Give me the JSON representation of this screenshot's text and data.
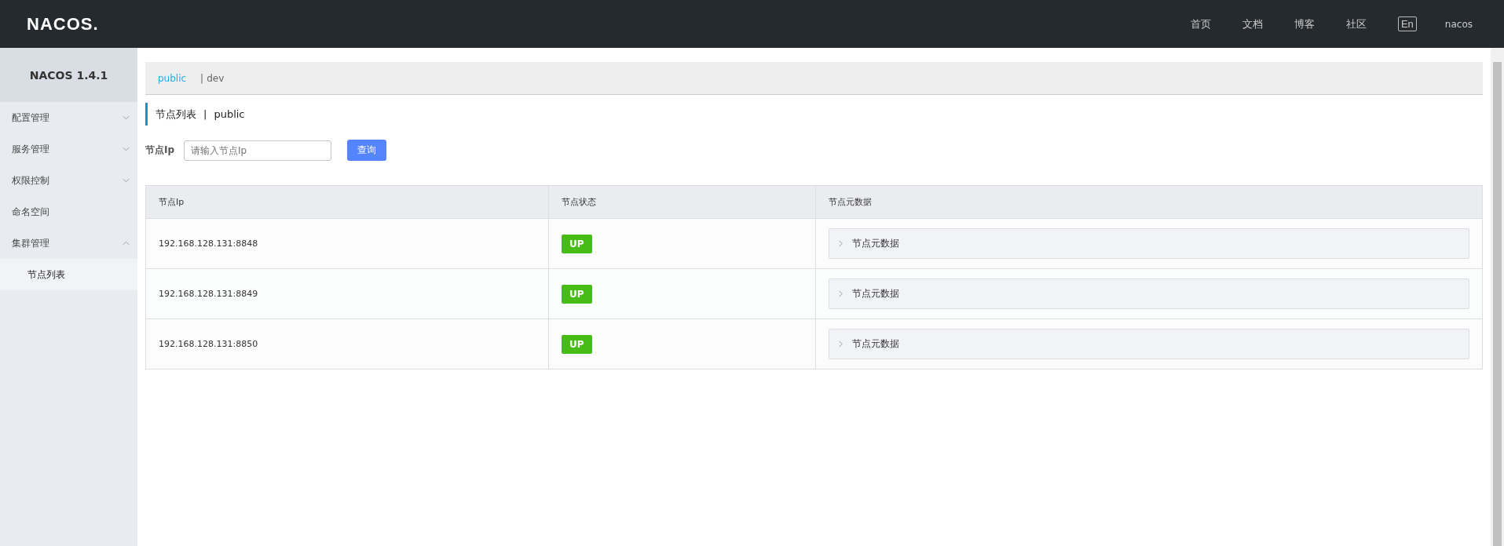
{
  "header": {
    "logo": "NACOS.",
    "nav": [
      "首页",
      "文档",
      "博客",
      "社区"
    ],
    "language": "En",
    "user": "nacos"
  },
  "sidebar": {
    "title": "NACOS 1.4.1",
    "items": [
      {
        "label": "配置管理",
        "expandable": true,
        "expanded": false
      },
      {
        "label": "服务管理",
        "expandable": true,
        "expanded": false
      },
      {
        "label": "权限控制",
        "expandable": true,
        "expanded": false
      },
      {
        "label": "命名空间",
        "expandable": false
      },
      {
        "label": "集群管理",
        "expandable": true,
        "expanded": true,
        "children": [
          {
            "label": "节点列表",
            "selected": true
          }
        ]
      }
    ]
  },
  "namespace_separator": "|",
  "namespaces": [
    {
      "label": "public",
      "selected": true
    },
    {
      "label": "dev",
      "selected": false
    }
  ],
  "page_title": {
    "title": "节点列表",
    "separator": "|",
    "namespace": "public"
  },
  "search": {
    "label": "节点Ip",
    "placeholder": "请输入节点Ip",
    "button": "查询"
  },
  "table": {
    "columns": [
      "节点Ip",
      "节点状态",
      "节点元数据"
    ],
    "rows": [
      {
        "ip": "192.168.128.131:8848",
        "status": "UP",
        "metadata": "节点元数据",
        "expanded": false
      },
      {
        "ip": "192.168.128.131:8849",
        "status": "UP",
        "metadata": "节点元数据",
        "expanded": false
      },
      {
        "ip": "192.168.128.131:8850",
        "status": "UP",
        "metadata": "节点元数据",
        "expanded": false
      }
    ]
  }
}
